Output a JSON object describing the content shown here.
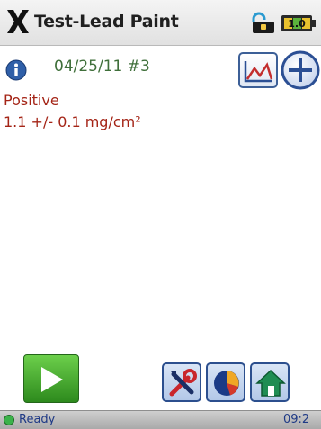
{
  "header": {
    "title": "Test-Lead Paint",
    "icons": [
      "close-x-icon",
      "lock-icon",
      "battery-icon"
    ],
    "battery_label": "1.0"
  },
  "reading": {
    "test_id": "04/25/11 #3",
    "result_status": "Positive",
    "result_value": "1.1 +/- 0.1 mg/cm²"
  },
  "toolbar": {
    "buttons": [
      "play-icon",
      "graph-icon",
      "add-icon",
      "tools-icon",
      "pie-chart-icon",
      "home-icon"
    ]
  },
  "statusbar": {
    "status": "Ready",
    "clock": "09:2"
  },
  "colors": {
    "result": "#a42416",
    "test_id": "#3f6f3a",
    "status_text": "#1f3a86",
    "accent_blue": "#2c4f8e",
    "play_green": "#2d8a1d"
  }
}
